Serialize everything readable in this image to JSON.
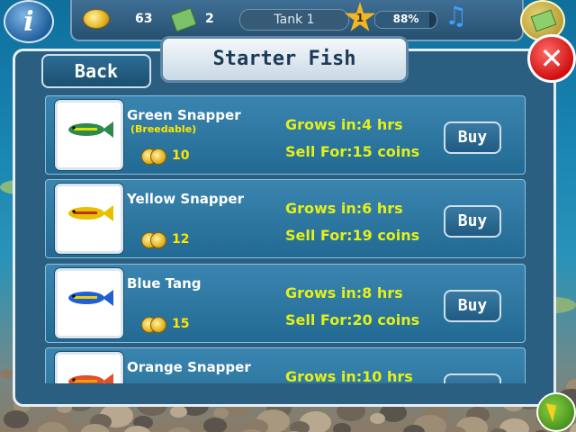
{
  "hud": {
    "coins": "63",
    "cash": "2",
    "tank_name": "Tank 1",
    "level": "1",
    "xp_percent": "88%",
    "xp_fraction": 0.88
  },
  "dialog": {
    "title": "Starter Fish",
    "back_label": "Back",
    "close_label": "✕"
  },
  "fish": [
    {
      "name": "Green Snapper",
      "tag": "(Breedable)",
      "price": "10",
      "grows": "Grows in:4 hrs",
      "sell": "Sell For:15 coins",
      "buy": "Buy",
      "color": "#2e8a4a",
      "stripe": "#e0e000"
    },
    {
      "name": "Yellow Snapper",
      "tag": "",
      "price": "12",
      "grows": "Grows in:6 hrs",
      "sell": "Sell For:19 coins",
      "buy": "Buy",
      "color": "#e8c000",
      "stripe": "#c03020"
    },
    {
      "name": "Blue Tang",
      "tag": "",
      "price": "15",
      "grows": "Grows in:8 hrs",
      "sell": "Sell For:20 coins",
      "buy": "Buy",
      "color": "#2060d0",
      "stripe": "#f0d000"
    },
    {
      "name": "Orange Snapper",
      "tag": "",
      "price": "",
      "grows": "Grows in:10 hrs",
      "sell": "",
      "buy": "",
      "color": "#e0502a",
      "stripe": "#f0a000"
    }
  ]
}
